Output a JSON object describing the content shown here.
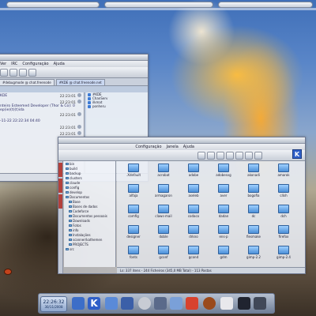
{
  "chat_window": {
    "menus": [
      "Ver",
      "IRC",
      "Configuração",
      "Ajuda"
    ],
    "tabs": [
      "#debugmode @ chat.freenode",
      "#KDE @ chat.freenode.net"
    ],
    "messages": [
      {
        "text": "KDE",
        "time": "22:23:01"
      },
      {
        "text": "",
        "time": "22:23:01"
      },
      {
        "text": "nteiro Esteemed Developer (Thor & Co): 0 ep(ie)(t)(t)ida",
        "time": ""
      },
      {
        "text": "",
        "time": "22:23:01"
      },
      {
        "text": "-11-22 22:22:34 04:40",
        "time": ""
      },
      {
        "text": "",
        "time": "22:23:01"
      },
      {
        "text": "",
        "time": "22:23:01"
      }
    ],
    "users": [
      "#KDE",
      "ChanServ",
      "ilkmat",
      "ponheru"
    ]
  },
  "file_manager": {
    "menus": [
      "Configuração",
      "Janela",
      "Ajuda"
    ],
    "tree": [
      "bin",
      "build",
      "backup",
      "clusters",
      "claude",
      "config",
      "develop",
      "Documentos",
      "Base",
      "Bases de dados",
      "Codeforce",
      "Documentos pessoais",
      "Downloads",
      "Fotos",
      "info",
      "Instalações",
      "scanner/kathemen",
      "PROJECTS",
      "src"
    ],
    "folders": [
      ".Xdefault",
      "acrobat",
      "adobe",
      "adobesvg",
      "akonadi",
      "amarok",
      "alfaja",
      "armagaron",
      "aseleb",
      "aver",
      "bogofia",
      "c4sh",
      "comfig",
      "claws-mail",
      "codaco",
      "dadan",
      "dc",
      "dch",
      "designer",
      "doble",
      "drkno",
      "ens-p",
      "fiesmake",
      "firefox",
      "fonts",
      "gconf",
      "gcond",
      "gdm",
      "gimp-2.2",
      "gimp-2.4"
    ],
    "status": "Ls: 337 itens - 244 Ficheiros (345,0 MB Total) - 113 Pastas"
  },
  "panel": {
    "clock_time": "22:26:32",
    "clock_date": "30/11/2008"
  },
  "colors": {
    "kde_blue": "#2f5fc8",
    "folder_blue": "#4b8fd8"
  }
}
